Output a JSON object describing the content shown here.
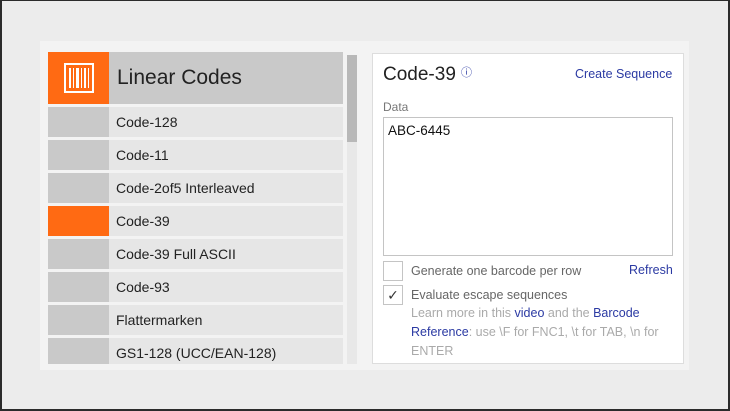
{
  "list": {
    "header_title": "Linear Codes",
    "header_icon": "barcode-icon",
    "items": [
      {
        "label": "Code-128",
        "selected": false
      },
      {
        "label": "Code-11",
        "selected": false
      },
      {
        "label": "Code-2of5 Interleaved",
        "selected": false
      },
      {
        "label": "Code-39",
        "selected": true
      },
      {
        "label": "Code-39 Full ASCII",
        "selected": false
      },
      {
        "label": "Code-93",
        "selected": false
      },
      {
        "label": "Flattermarken",
        "selected": false
      },
      {
        "label": "GS1-128 (UCC/EAN-128)",
        "selected": false
      }
    ]
  },
  "detail": {
    "title": "Code-39",
    "info_icon": "ⓘ",
    "create_sequence": "Create Sequence",
    "data_label": "Data",
    "data_value": "ABC-6445",
    "option_one_per_row": {
      "label": "Generate one barcode per row",
      "checked": false
    },
    "refresh": "Refresh",
    "option_escape": {
      "label": "Evaluate escape sequences",
      "checked": true,
      "check_mark": "✓"
    },
    "help": {
      "part1": "Learn more in this ",
      "link_video": "video",
      "part2": " and the ",
      "link_reference": "Barcode Reference",
      "part3": ": use \\F for FNC1, \\t for TAB, \\n for ENTER"
    }
  },
  "colors": {
    "accent": "#ff6a13",
    "link": "#2b3aa3"
  }
}
